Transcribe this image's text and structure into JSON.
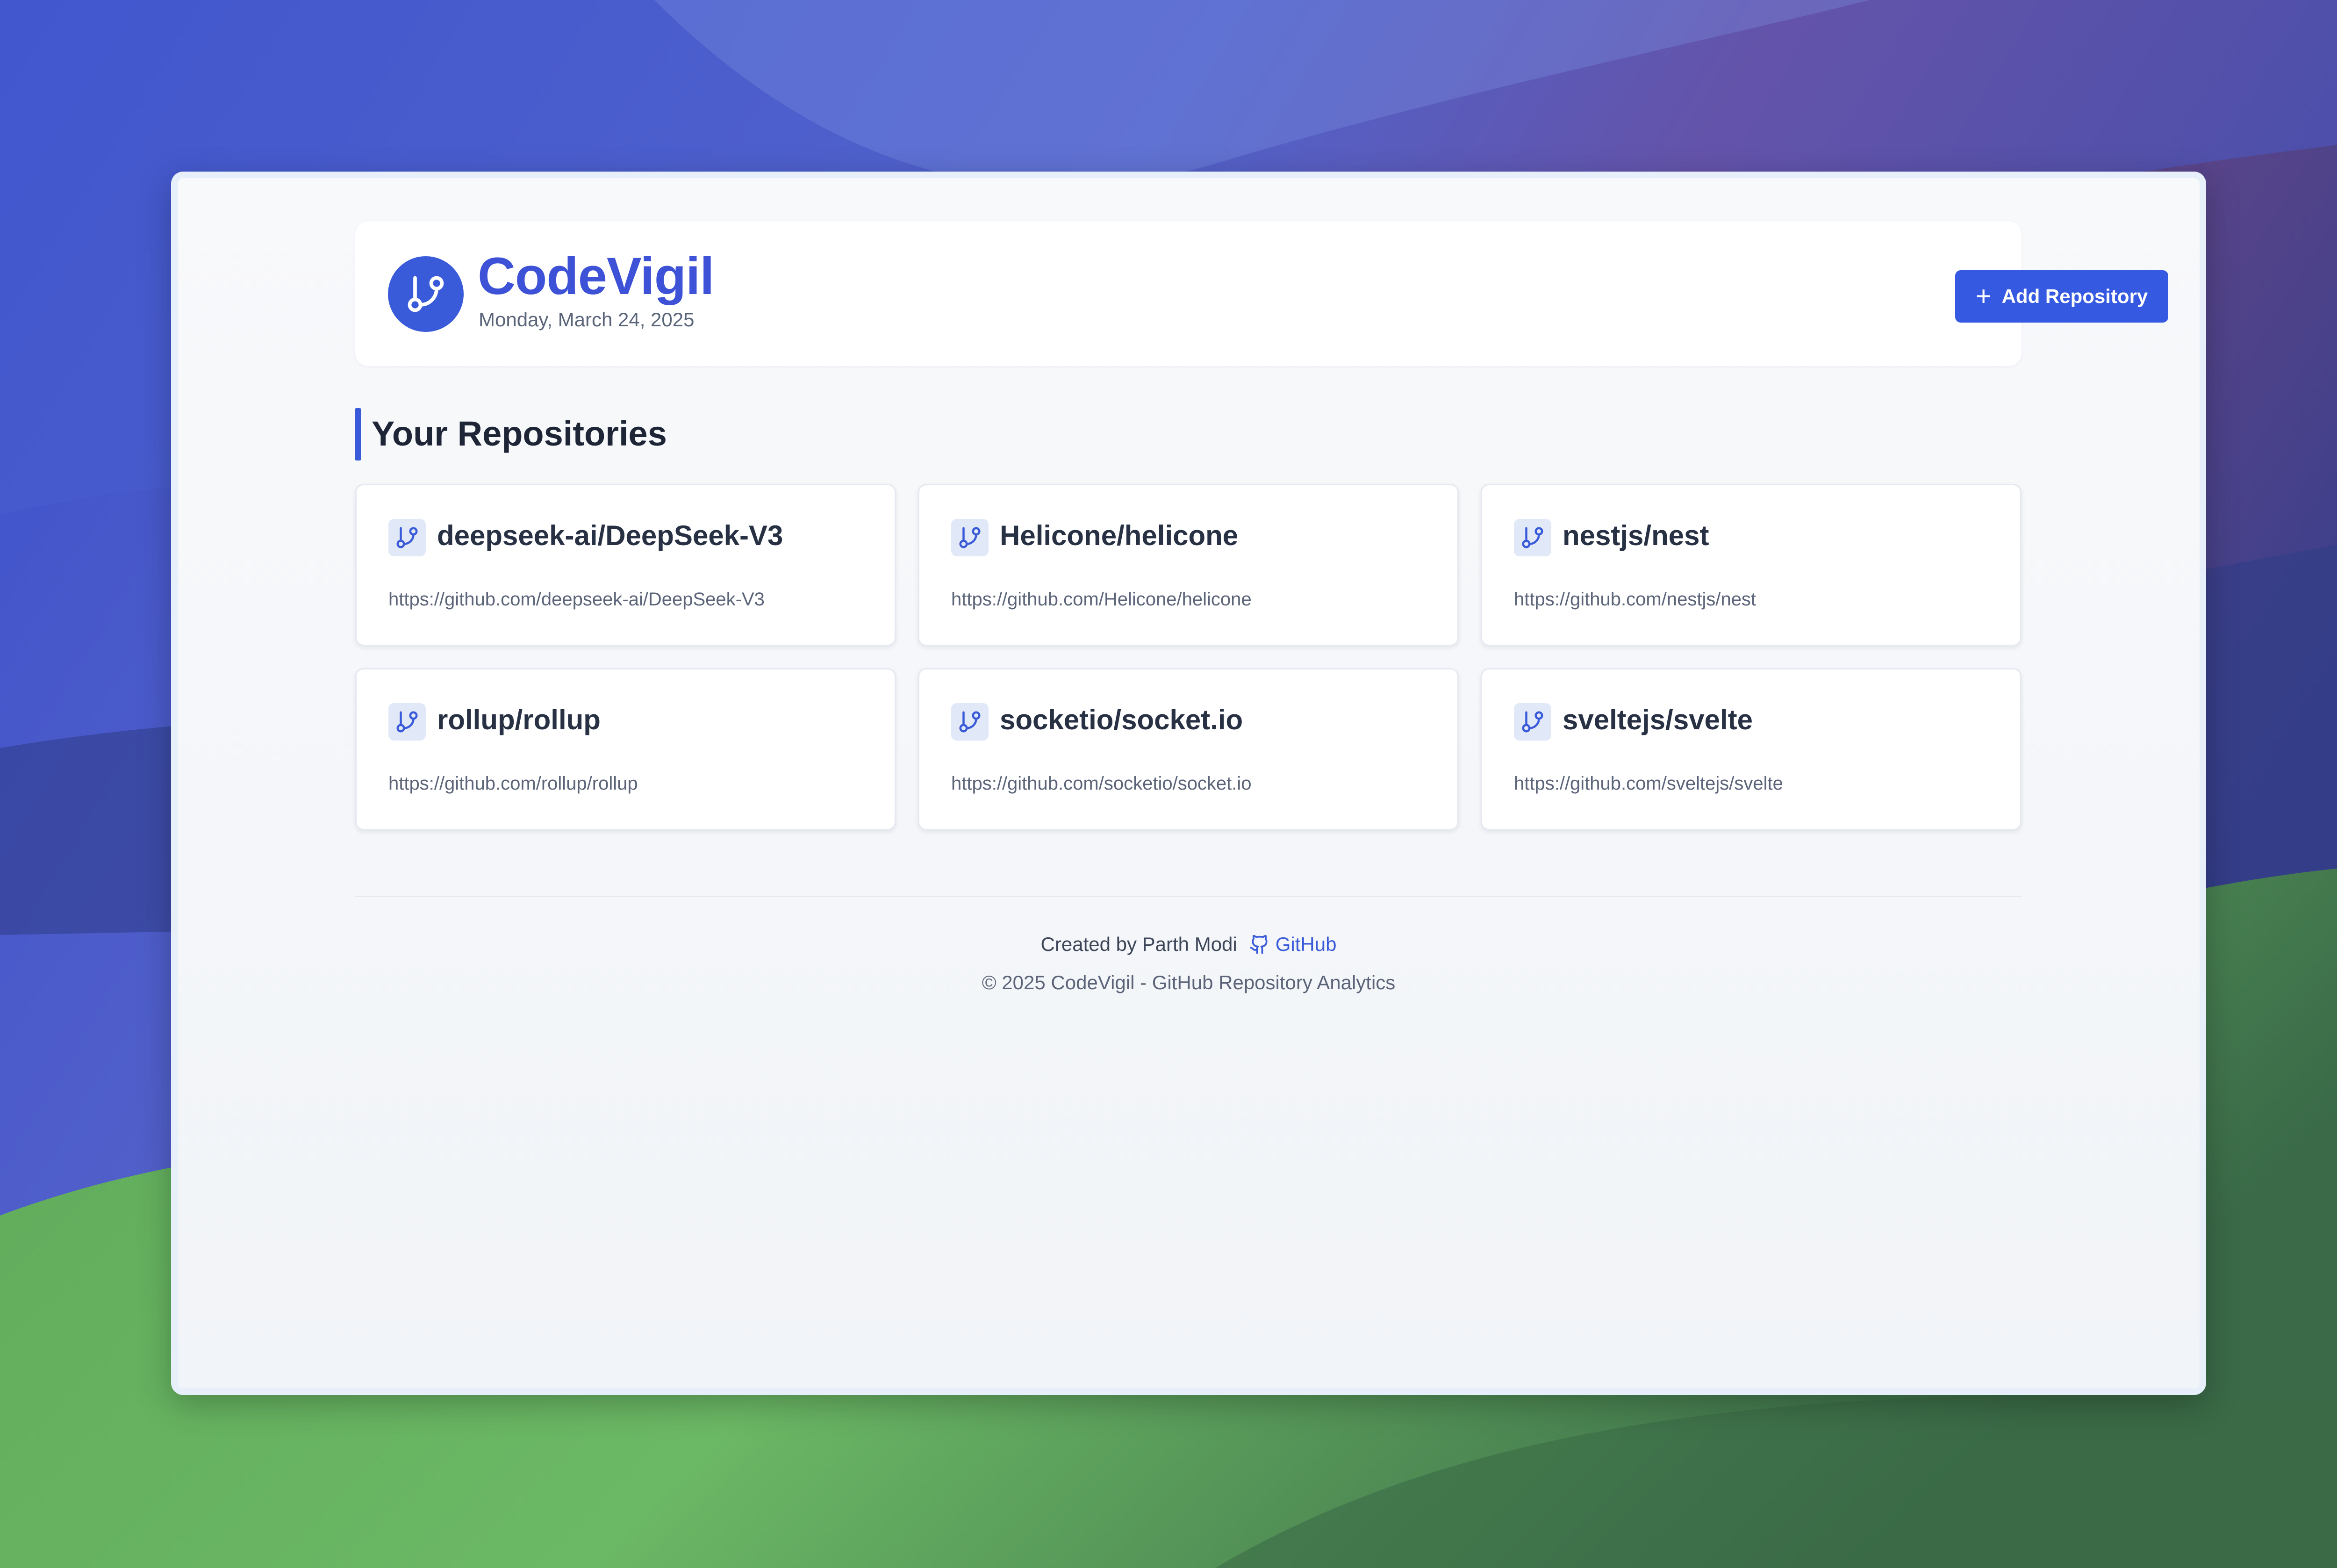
{
  "brand": {
    "name": "CodeVigil",
    "date": "Monday, March 24, 2025",
    "accent": "#3a5bd9"
  },
  "header": {
    "add_button_label": "Add Repository",
    "add_icon": "plus-icon"
  },
  "section": {
    "title": "Your Repositories"
  },
  "repositories": [
    {
      "name": "deepseek-ai/DeepSeek-V3",
      "url": "https://github.com/deepseek-ai/DeepSeek-V3",
      "icon": "git-branch-icon"
    },
    {
      "name": "Helicone/helicone",
      "url": "https://github.com/Helicone/helicone",
      "icon": "git-branch-icon"
    },
    {
      "name": "nestjs/nest",
      "url": "https://github.com/nestjs/nest",
      "icon": "git-branch-icon"
    },
    {
      "name": "rollup/rollup",
      "url": "https://github.com/rollup/rollup",
      "icon": "git-branch-icon"
    },
    {
      "name": "socketio/socket.io",
      "url": "https://github.com/socketio/socket.io",
      "icon": "git-branch-icon"
    },
    {
      "name": "sveltejs/svelte",
      "url": "https://github.com/sveltejs/svelte",
      "icon": "git-branch-icon"
    }
  ],
  "footer": {
    "created_by": "Created by Parth Modi",
    "github_label": "GitHub",
    "github_icon": "github-icon",
    "copyright": "© 2025 CodeVigil - GitHub Repository Analytics"
  }
}
